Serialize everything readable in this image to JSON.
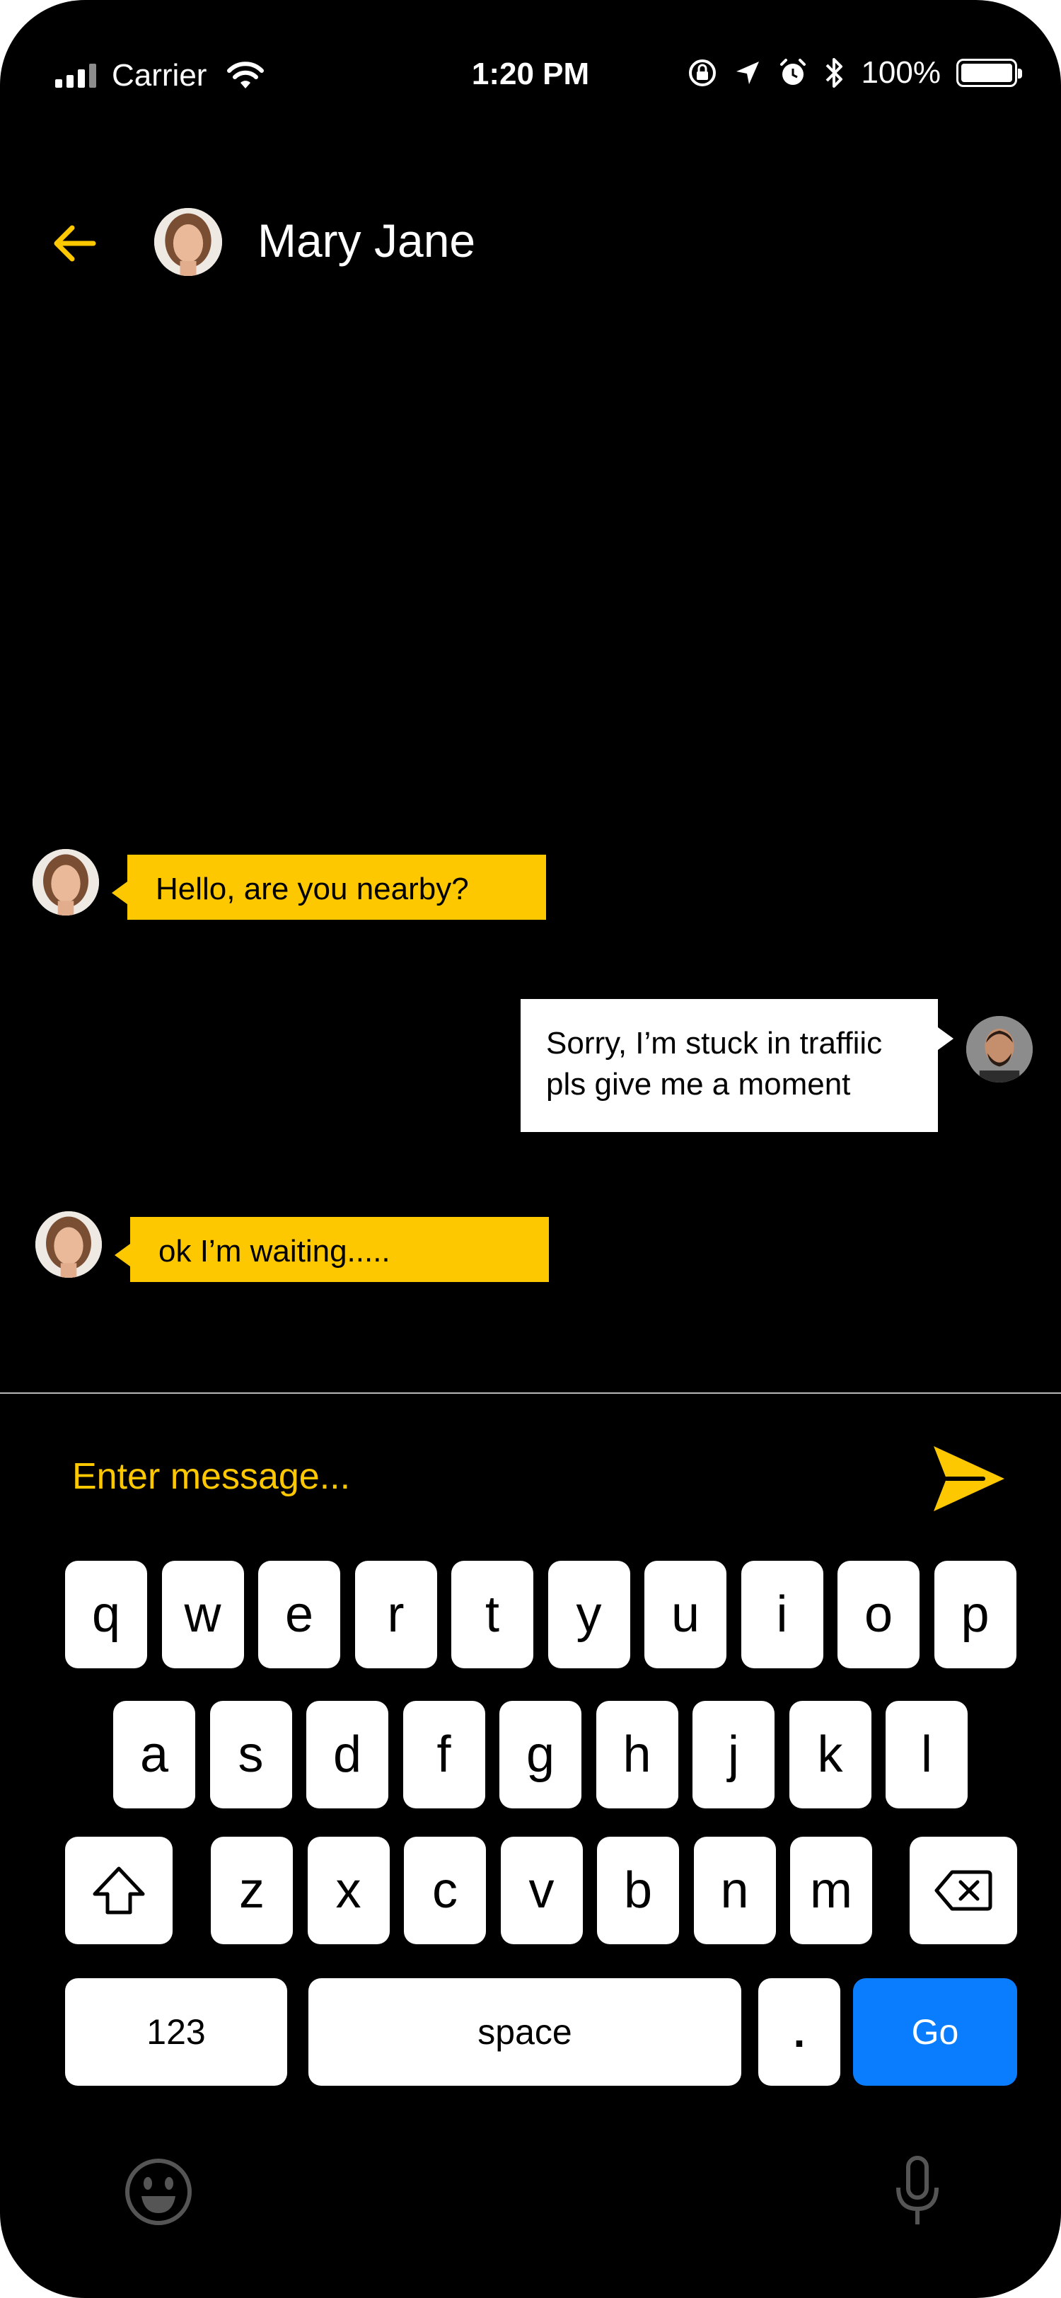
{
  "status_bar": {
    "carrier": "Carrier",
    "time": "1:20 PM",
    "battery": "100%"
  },
  "header": {
    "contact_name": "Mary Jane"
  },
  "messages": [
    {
      "sender": "contact",
      "text": "Hello, are you nearby?"
    },
    {
      "sender": "me",
      "line1": "Sorry, I’m stuck in traffiic",
      "line2": "pls give me a moment"
    },
    {
      "sender": "contact",
      "text": "ok I’m waiting....."
    }
  ],
  "composer": {
    "placeholder": "Enter message..."
  },
  "keyboard": {
    "row1": [
      "q",
      "w",
      "e",
      "r",
      "t",
      "y",
      "u",
      "i",
      "o",
      "p"
    ],
    "row2": [
      "a",
      "s",
      "d",
      "f",
      "g",
      "h",
      "j",
      "k",
      "l"
    ],
    "row3": [
      "z",
      "x",
      "c",
      "v",
      "b",
      "n",
      "m"
    ],
    "numbers": "123",
    "space": "space",
    "period": ".",
    "go": "Go"
  },
  "colors": {
    "accent": "#fec801",
    "go_button": "#0a7dff",
    "background": "#000000"
  }
}
